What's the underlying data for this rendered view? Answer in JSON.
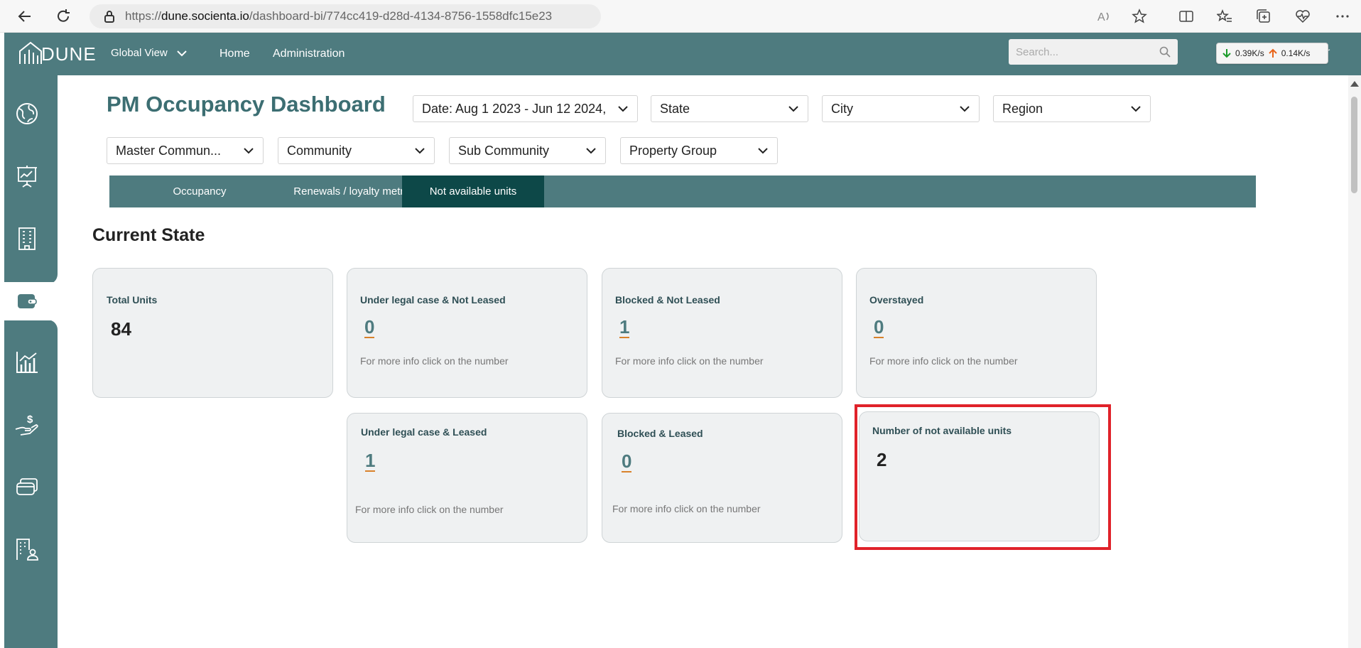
{
  "browser": {
    "url_host": "dune.socienta.io",
    "url_path": "/dashboard-bi/774cc419-d28d-4134-8756-1558dfc15e23",
    "url_prefix": "https://"
  },
  "header": {
    "logo_text": "DUNE",
    "global_view_label": "Global View",
    "nav": [
      "Home",
      "Administration"
    ],
    "search_placeholder": "Search...",
    "net_down": "0.39K/s",
    "net_up": "0.14K/s",
    "user_fragment": "ger"
  },
  "sidebar": {
    "items": [
      "globe-icon",
      "presentation-icon",
      "building-icon",
      "wallet-icon",
      "chart-icon",
      "payment-hand-icon",
      "layers-icon",
      "building-person-icon"
    ],
    "active_index": 3
  },
  "dashboard": {
    "title": "PM Occupancy Dashboard",
    "filters_row1": [
      "Date: Aug 1 2023 - Jun 12 2024,",
      "State",
      "City",
      "Region"
    ],
    "filters_row2": [
      "Master Commun...",
      "Community",
      "Sub Community",
      "Property Group"
    ],
    "tabs": [
      "Occupancy",
      "Renewals / loyalty metrics",
      "Not available units"
    ],
    "active_tab": "Not available units",
    "section_title": "Current State",
    "hint": "For more info click on the number",
    "cards": {
      "total_units": {
        "label": "Total Units",
        "value": "84"
      },
      "legal_not_leased": {
        "label": "Under legal case & Not Leased",
        "value": "0"
      },
      "blocked_not_leased": {
        "label": "Blocked & Not Leased",
        "value": "1"
      },
      "overstayed": {
        "label": "Overstayed",
        "value": "0"
      },
      "legal_leased": {
        "label": "Under legal case & Leased",
        "value": "1"
      },
      "blocked_leased": {
        "label": "Blocked & Leased",
        "value": "0"
      },
      "not_available": {
        "label": "Number of not available units",
        "value": "2"
      }
    }
  },
  "colors": {
    "primary": "#4e7b7f",
    "tab_active": "#0d4848",
    "highlight": "#e0222a",
    "link_underline": "#d9822b"
  }
}
